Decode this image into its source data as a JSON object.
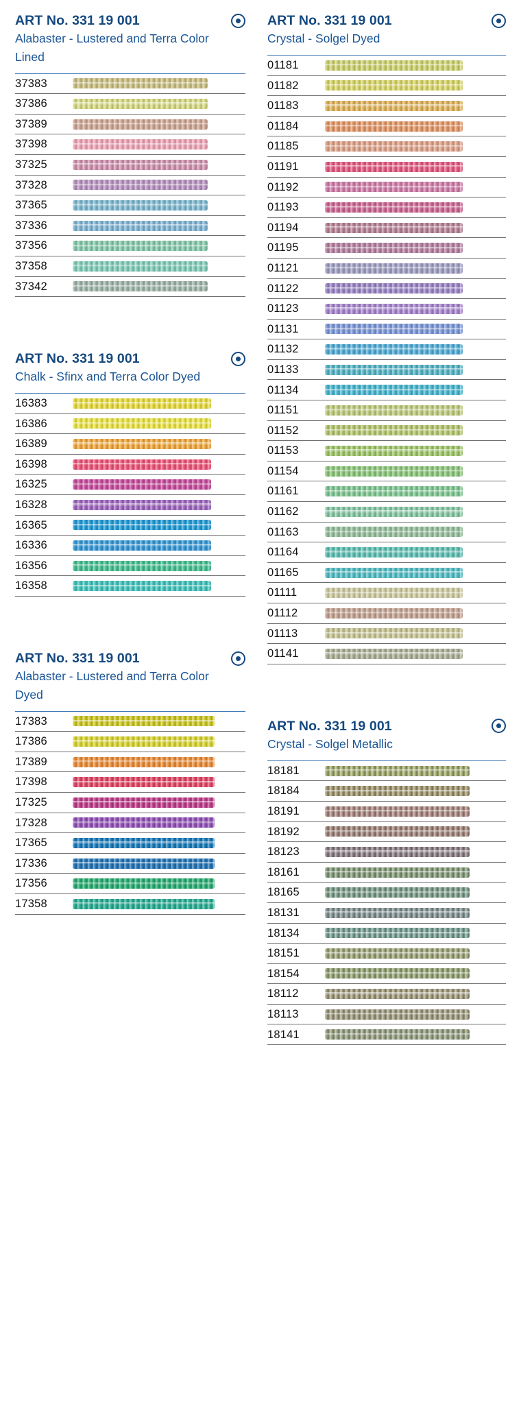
{
  "meta": {
    "header_color": "#15497f",
    "rule_color": "#3f78b5",
    "row_line_color": "#6d6d6d",
    "code_color": "#111111"
  },
  "panels": [
    {
      "id": "alabaster-lustered-terra-lined",
      "column": "left",
      "art_no": "ART No. 331 19 001",
      "icon": "finish-circle-icon",
      "subtitle": "Alabaster - Lustered and Terra Color Lined",
      "texture": "gloss",
      "strip_width_pct": 78,
      "rows": [
        {
          "code": "37383",
          "color": "#c9bd7e"
        },
        {
          "code": "37386",
          "color": "#d5d97f"
        },
        {
          "code": "37389",
          "color": "#cda391"
        },
        {
          "code": "37398",
          "color": "#eea3b4"
        },
        {
          "code": "37325",
          "color": "#cf90ad"
        },
        {
          "code": "37328",
          "color": "#b791c0"
        },
        {
          "code": "37365",
          "color": "#79b6cf"
        },
        {
          "code": "37336",
          "color": "#7fb4d4"
        },
        {
          "code": "37356",
          "color": "#84c9ab"
        },
        {
          "code": "37358",
          "color": "#7ecbb6"
        },
        {
          "code": "37342",
          "color": "#9db3a8"
        }
      ]
    },
    {
      "id": "chalk-sfinx-terra-dyed",
      "column": "left",
      "art_no": "ART No. 331 19 001",
      "icon": "finish-circle-icon",
      "subtitle": "Chalk - Sfinx and Terra Color Dyed",
      "texture": "gloss",
      "strip_width_pct": 80,
      "rows": [
        {
          "code": "16383",
          "color": "#e5d936"
        },
        {
          "code": "16386",
          "color": "#e9e23f"
        },
        {
          "code": "16389",
          "color": "#f0a637"
        },
        {
          "code": "16398",
          "color": "#ec5175"
        },
        {
          "code": "16325",
          "color": "#c5469a"
        },
        {
          "code": "16328",
          "color": "#9c63bd"
        },
        {
          "code": "16365",
          "color": "#1f9ad6"
        },
        {
          "code": "16336",
          "color": "#3094d4"
        },
        {
          "code": "16356",
          "color": "#41bd8f"
        },
        {
          "code": "16358",
          "color": "#3fc2bb"
        }
      ]
    },
    {
      "id": "alabaster-lustered-terra-dyed",
      "column": "left",
      "art_no": "ART No. 331 19 001",
      "icon": "finish-circle-icon",
      "subtitle": "Alabaster - Lustered and Terra Color Dyed",
      "texture": "gloss",
      "strip_width_pct": 82,
      "rows": [
        {
          "code": "17383",
          "color": "#cbc620"
        },
        {
          "code": "17386",
          "color": "#d6d32b"
        },
        {
          "code": "17389",
          "color": "#e98a34"
        },
        {
          "code": "17398",
          "color": "#e14363"
        },
        {
          "code": "17325",
          "color": "#bc3787"
        },
        {
          "code": "17328",
          "color": "#8e4cb4"
        },
        {
          "code": "17365",
          "color": "#1477b8"
        },
        {
          "code": "17336",
          "color": "#1f71b4"
        },
        {
          "code": "17356",
          "color": "#21a96c"
        },
        {
          "code": "17358",
          "color": "#23ab92"
        }
      ]
    },
    {
      "id": "crystal-solgel-dyed",
      "column": "right",
      "art_no": "ART No. 331 19 001",
      "icon": "finish-circle-icon",
      "subtitle": "Crystal - Solgel Dyed",
      "texture": "gloss",
      "strip_width_pct": 76,
      "rows": [
        {
          "code": "01181",
          "color": "#cbd06a"
        },
        {
          "code": "01182",
          "color": "#d7d464"
        },
        {
          "code": "01183",
          "color": "#e0b257"
        },
        {
          "code": "01184",
          "color": "#e29463"
        },
        {
          "code": "01185",
          "color": "#dda086"
        },
        {
          "code": "01191",
          "color": "#e2577f"
        },
        {
          "code": "01192",
          "color": "#cf7ba8"
        },
        {
          "code": "01193",
          "color": "#c9618e"
        },
        {
          "code": "01194",
          "color": "#b57f93"
        },
        {
          "code": "01195",
          "color": "#b57fa0"
        },
        {
          "code": "01121",
          "color": "#9d9cc1"
        },
        {
          "code": "01122",
          "color": "#9781c4"
        },
        {
          "code": "01123",
          "color": "#a583cd"
        },
        {
          "code": "01131",
          "color": "#7b97d8"
        },
        {
          "code": "01132",
          "color": "#4aa8d4"
        },
        {
          "code": "01133",
          "color": "#52b3c4"
        },
        {
          "code": "01134",
          "color": "#45b5cf"
        },
        {
          "code": "01151",
          "color": "#bcc878"
        },
        {
          "code": "01152",
          "color": "#b2c46b"
        },
        {
          "code": "01153",
          "color": "#9dc566"
        },
        {
          "code": "01154",
          "color": "#88c477"
        },
        {
          "code": "01161",
          "color": "#7cc590"
        },
        {
          "code": "01162",
          "color": "#84c6a2"
        },
        {
          "code": "01163",
          "color": "#94bd9a"
        },
        {
          "code": "01164",
          "color": "#58bcb0"
        },
        {
          "code": "01165",
          "color": "#51bcc4"
        },
        {
          "code": "01111",
          "color": "#cdcaa0"
        },
        {
          "code": "01112",
          "color": "#c2a08f"
        },
        {
          "code": "01113",
          "color": "#c6c392"
        },
        {
          "code": "01141",
          "color": "#a8ad93"
        }
      ]
    },
    {
      "id": "crystal-solgel-metallic",
      "column": "right",
      "art_no": "ART No. 331 19 001",
      "icon": "finish-circle-icon",
      "subtitle": "Crystal - Solgel Metallic",
      "texture": "metallic",
      "strip_width_pct": 80,
      "rows": [
        {
          "code": "18181",
          "color": "#a8b173"
        },
        {
          "code": "18184",
          "color": "#a99e77"
        },
        {
          "code": "18191",
          "color": "#b08e85"
        },
        {
          "code": "18192",
          "color": "#a5897f"
        },
        {
          "code": "18123",
          "color": "#90838a"
        },
        {
          "code": "18161",
          "color": "#8aa27f"
        },
        {
          "code": "18165",
          "color": "#7ea08b"
        },
        {
          "code": "18131",
          "color": "#8a9a9a"
        },
        {
          "code": "18134",
          "color": "#7fa79c"
        },
        {
          "code": "18151",
          "color": "#a3a97c"
        },
        {
          "code": "18154",
          "color": "#9aa878"
        },
        {
          "code": "18112",
          "color": "#a9a284"
        },
        {
          "code": "18113",
          "color": "#a4a184"
        },
        {
          "code": "18141",
          "color": "#9ba486"
        }
      ]
    }
  ]
}
